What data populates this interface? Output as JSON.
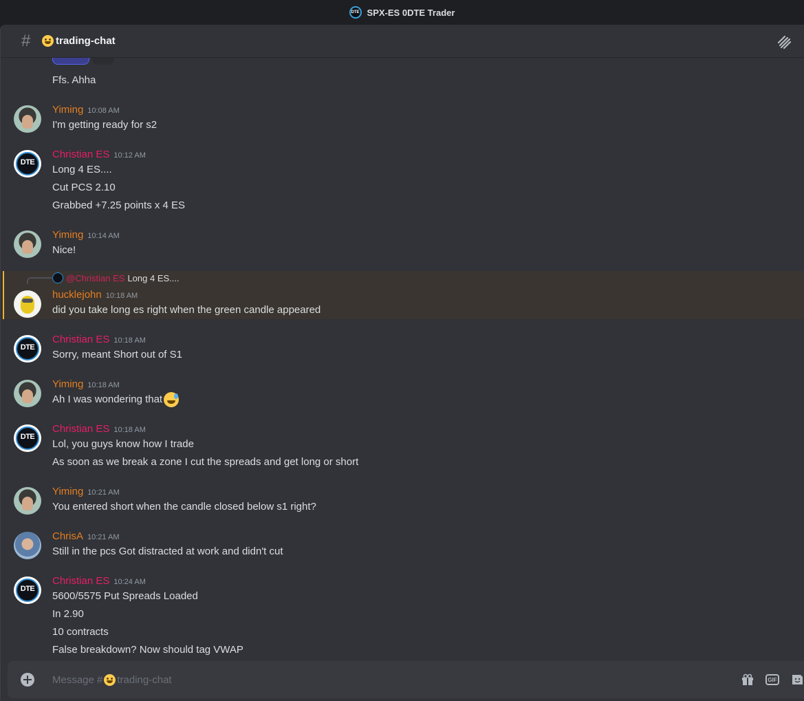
{
  "window": {
    "title": "SPX-ES 0DTE Trader",
    "logo_text": "DTE"
  },
  "channel": {
    "name": "trading-chat",
    "hash": "#"
  },
  "messages": {
    "m0": {
      "lines": [
        "Ffs.  Ahha"
      ]
    },
    "m1": {
      "author": "Yiming",
      "time": "10:08 AM",
      "lines": [
        "I'm getting ready for s2"
      ]
    },
    "m2": {
      "author": "Christian ES",
      "time": "10:12 AM",
      "lines": [
        "Long 4 ES....",
        "Cut PCS  2.10",
        "Grabbed +7.25 points x 4 ES"
      ]
    },
    "m3": {
      "author": "Yiming",
      "time": "10:14 AM",
      "lines": [
        "Nice!"
      ]
    },
    "m4": {
      "reply": {
        "mention": "@Christian ES",
        "text": "Long 4 ES...."
      },
      "author": "hucklejohn",
      "time": "10:18 AM",
      "lines": [
        "did you take long es right when the green candle appeared"
      ]
    },
    "m5": {
      "author": "Christian ES",
      "time": "10:18 AM",
      "lines": [
        "Sorry, meant Short out of S1"
      ]
    },
    "m6": {
      "author": "Yiming",
      "time": "10:18 AM",
      "lines": [
        "Ah I was wondering that"
      ]
    },
    "m7": {
      "author": "Christian ES",
      "time": "10:18 AM",
      "lines": [
        "Lol, you guys know how I trade",
        "As soon as we break a zone I cut the spreads and get long or short"
      ]
    },
    "m8": {
      "author": "Yiming",
      "time": "10:21 AM",
      "lines": [
        "You entered short when the candle closed below s1 right?"
      ]
    },
    "m9": {
      "author": "ChrisA",
      "time": "10:21 AM",
      "lines": [
        "Still in the pcs    Got distracted at work and didn't cut"
      ]
    },
    "m10": {
      "author": "Christian ES",
      "time": "10:24 AM",
      "lines": [
        "5600/5575 Put Spreads Loaded",
        "In 2.90",
        "10 contracts",
        "False breakdown?  Now should tag VWAP"
      ]
    }
  },
  "composer": {
    "placeholder_prefix": "Message #",
    "placeholder_channel": "trading-chat",
    "gif_label": "GIF"
  },
  "colors": {
    "yiming": "#e67e22",
    "christian": "#e91e63",
    "highlight_border": "#f0b232"
  },
  "icons": [
    "threads-icon",
    "plus-icon",
    "gift-icon",
    "gif-icon",
    "sticker-icon",
    "smile-emoji-icon",
    "sweat-smile-emoji-icon"
  ]
}
